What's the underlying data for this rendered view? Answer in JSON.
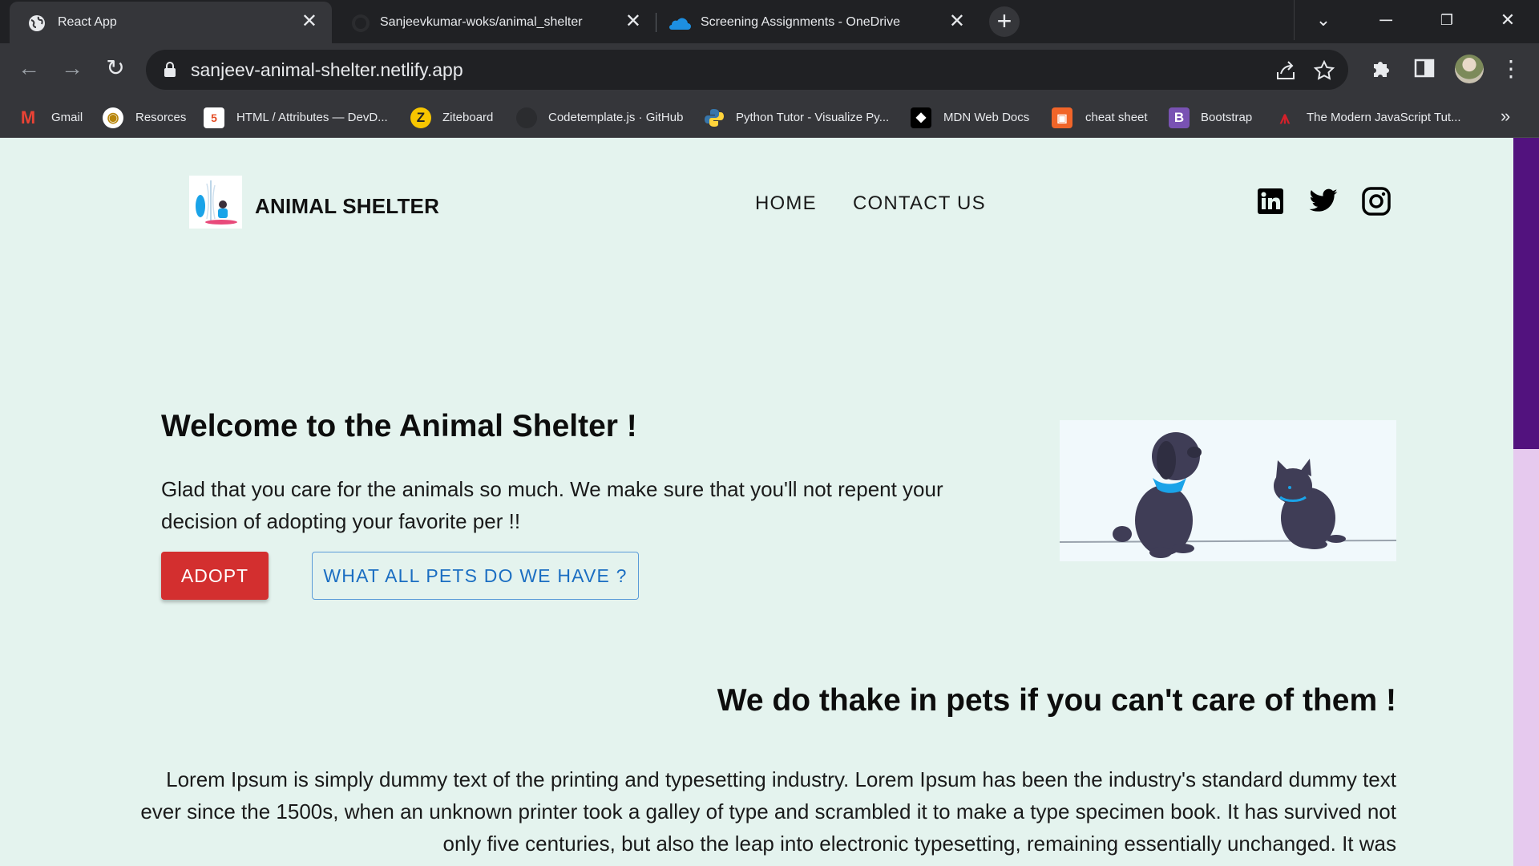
{
  "browser": {
    "tabs": [
      {
        "title": "React App",
        "icon": "globe-icon",
        "active": true
      },
      {
        "title": "Sanjeevkumar-woks/animal_shelter",
        "icon": "github-icon",
        "active": false
      },
      {
        "title": "Screening Assignments - OneDrive",
        "icon": "onedrive-icon",
        "active": false
      }
    ],
    "url": "sanjeev-animal-shelter.netlify.app",
    "bookmarks": [
      {
        "label": "Gmail",
        "icon": "gmail-icon",
        "color": "#ea4335"
      },
      {
        "label": "Resorces",
        "icon": "resources-icon",
        "color": "#f4b400"
      },
      {
        "label": "HTML / Attributes — DevD...",
        "icon": "devdocs-icon",
        "color": "#e44d26"
      },
      {
        "label": "Ziteboard",
        "icon": "ziteboard-icon",
        "color": "#f7c600"
      },
      {
        "label": "Codetemplate.js · GitHub",
        "icon": "github-icon",
        "color": "#24292e"
      },
      {
        "label": "Python Tutor - Visualize Py...",
        "icon": "python-icon",
        "color": "#3776ab"
      },
      {
        "label": "MDN Web Docs",
        "icon": "mdn-icon",
        "color": "#000000"
      },
      {
        "label": "cheat sheet",
        "icon": "cheatsheet-icon",
        "color": "#f16529"
      },
      {
        "label": "Bootstrap",
        "icon": "bootstrap-icon",
        "color": "#7952b3"
      },
      {
        "label": "The Modern JavaScript Tut...",
        "icon": "javascript-info-icon",
        "color": "#d5202a"
      }
    ]
  },
  "site": {
    "brand": "ANIMAL SHELTER",
    "nav": {
      "home": "HOME",
      "contact": "CONTACT US"
    },
    "social": [
      "linkedin-icon",
      "twitter-icon",
      "instagram-icon"
    ],
    "hero": {
      "title": "Welcome to the Animal Shelter !",
      "text": "Glad that you care for the animals so much. We make sure that you'll not repent your decision of adopting your favorite per !!",
      "adopt_label": "ADOPT",
      "pets_label": "WHAT ALL PETS DO WE HAVE ?"
    },
    "section": {
      "title": "We do thake in pets if you can't care of them !",
      "text": "Lorem Ipsum is simply dummy text of the printing and typesetting industry. Lorem Ipsum has been the industry's standard dummy text ever since the 1500s, when an unknown printer took a galley of type and scrambled it to make a type specimen book. It has survived not only five centuries, but also the leap into electronic typesetting, remaining essentially unchanged. It was"
    }
  },
  "colors": {
    "page_bg": "#e4f3ee",
    "adopt_button": "#d32f2f",
    "outline_button": "#1b6ec2",
    "scrollbar_thumb": "#52127e"
  }
}
